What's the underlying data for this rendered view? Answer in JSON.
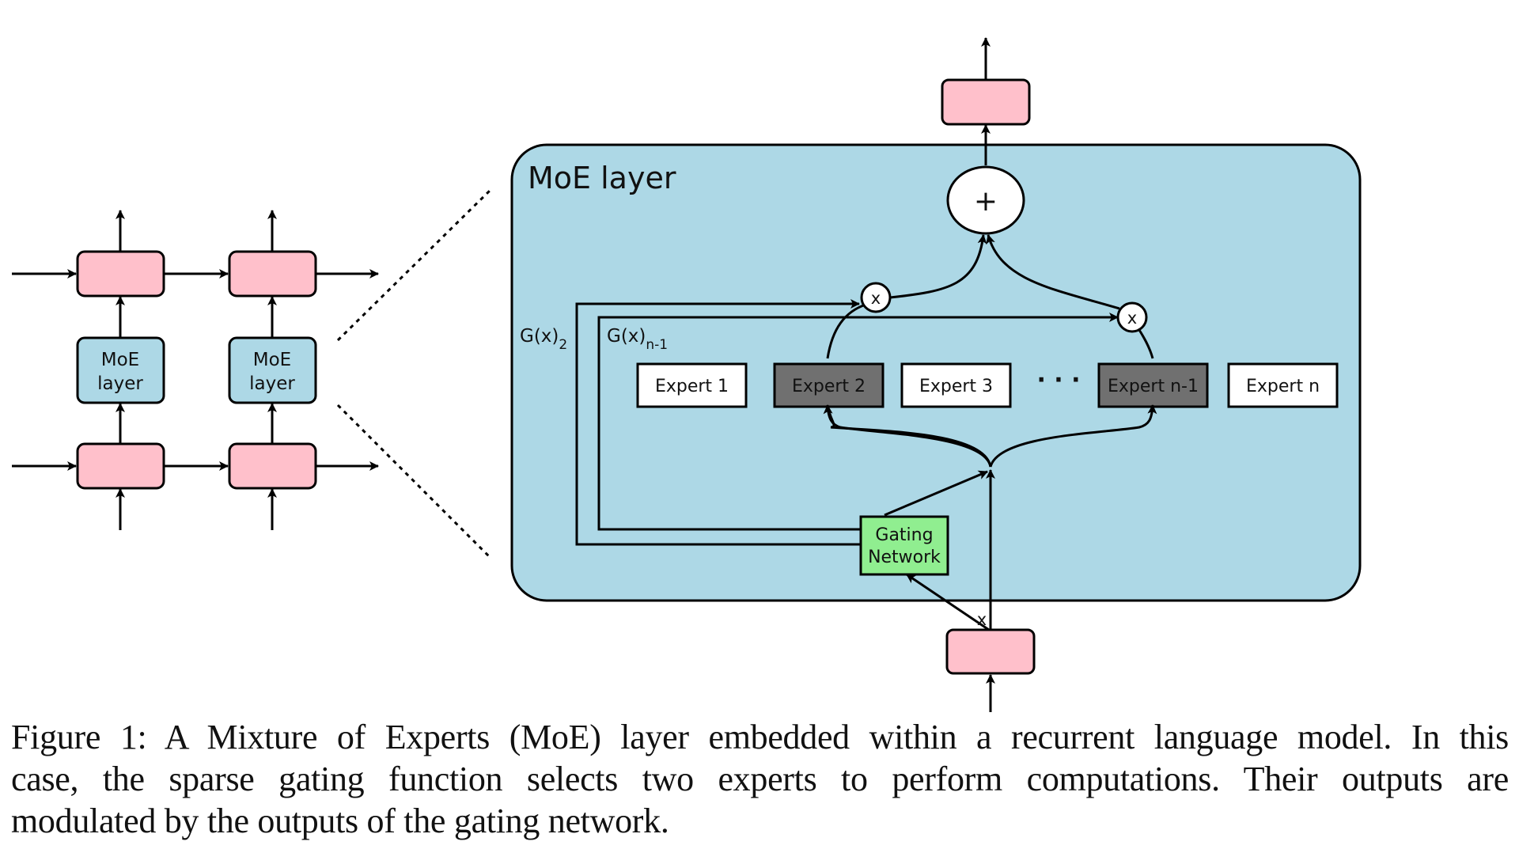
{
  "figure": {
    "left_stack": {
      "moe_label_line1": "MoE",
      "moe_label_line2": "layer"
    },
    "moe_layer": {
      "title": "MoE layer",
      "plus_symbol": "+",
      "multiply_symbol": "x",
      "gate_label_2": "G(x)",
      "gate_label_2_sub": "2",
      "gate_label_n1": "G(x)",
      "gate_label_n1_sub": "n-1",
      "ellipsis": "· · ·",
      "input_label": "x",
      "gating_network_line1": "Gating",
      "gating_network_line2": "Network",
      "experts": [
        {
          "label": "Expert 1",
          "selected": false
        },
        {
          "label": "Expert 2",
          "selected": true
        },
        {
          "label": "Expert 3",
          "selected": false
        },
        {
          "label": "Expert n-1",
          "selected": true
        },
        {
          "label": "Expert n",
          "selected": false
        }
      ]
    },
    "colors": {
      "rnn_cell": "#ffc0cb",
      "moe_bg": "#add8e6",
      "gating": "#90ee90",
      "expert_selected": "#707070",
      "expert_unselected": "#ffffff"
    }
  },
  "caption": {
    "lines": [
      "Figure 1: A Mixture of Experts (MoE) layer embedded within a recurrent language model. In this",
      "case, the sparse gating function selects two experts to perform computations.  Their outputs are",
      "modulated by the outputs of the gating network."
    ]
  }
}
